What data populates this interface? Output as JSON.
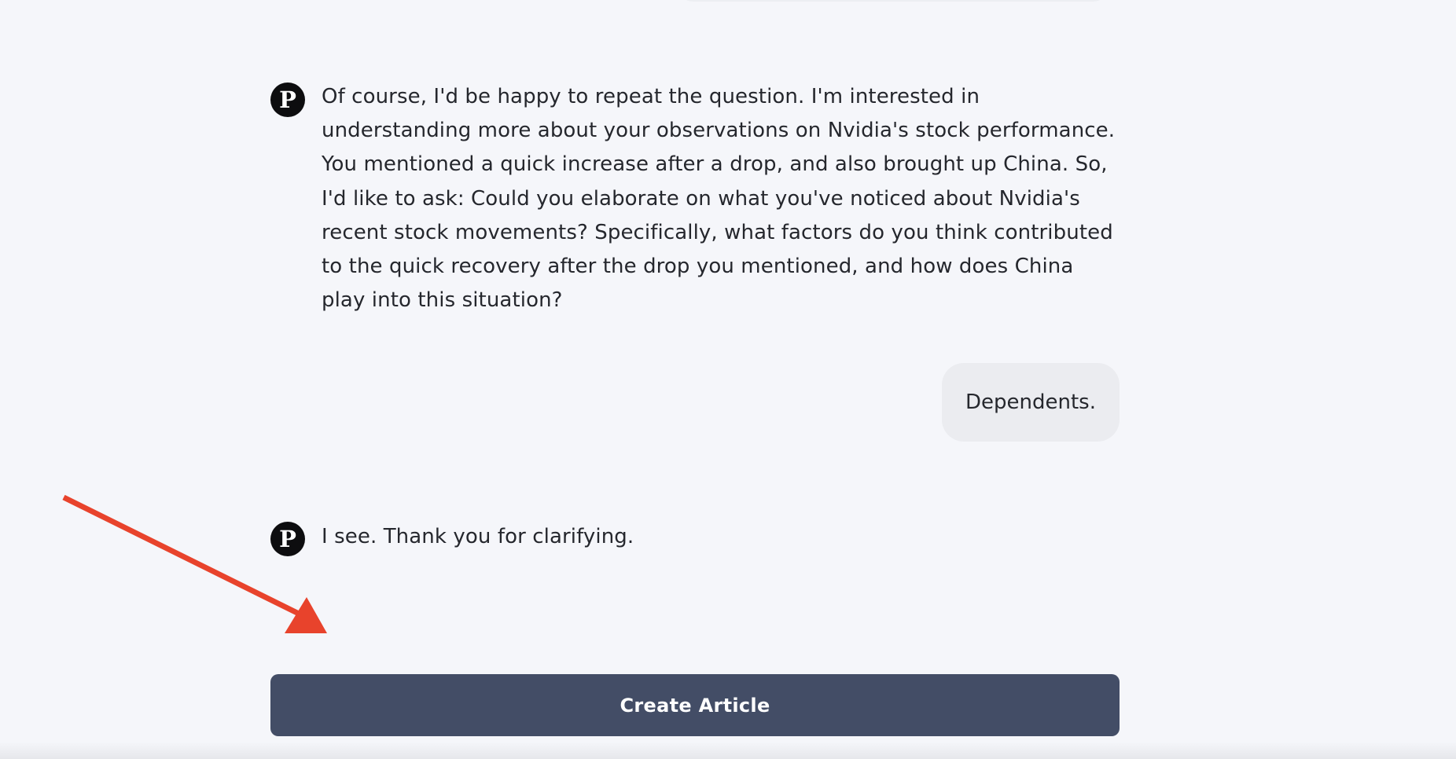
{
  "conversation": {
    "messages": [
      {
        "role": "assistant",
        "avatar_letter": "P",
        "text": "Of course, I'd be happy to repeat the question. I'm interested in understanding more about your observations on Nvidia's stock performance. You mentioned a quick increase after a drop, and also brought up China. So, I'd like to ask: Could you elaborate on what you've noticed about Nvidia's recent stock movements? Specifically, what factors do you think contributed to the quick recovery after the drop you mentioned, and how does China play into this situation?"
      },
      {
        "role": "user",
        "text": "Dependents."
      },
      {
        "role": "assistant",
        "avatar_letter": "P",
        "text": "I see. Thank you for clarifying."
      }
    ]
  },
  "actions": {
    "create_article_label": "Create Article"
  },
  "annotation": {
    "arrow_color": "#e8432c",
    "arrow_target": "create-article-button"
  },
  "colors": {
    "page_background": "#f5f6fa",
    "user_bubble": "#ebecf0",
    "button_background": "#434d66",
    "avatar_background": "#0d0d0f"
  }
}
